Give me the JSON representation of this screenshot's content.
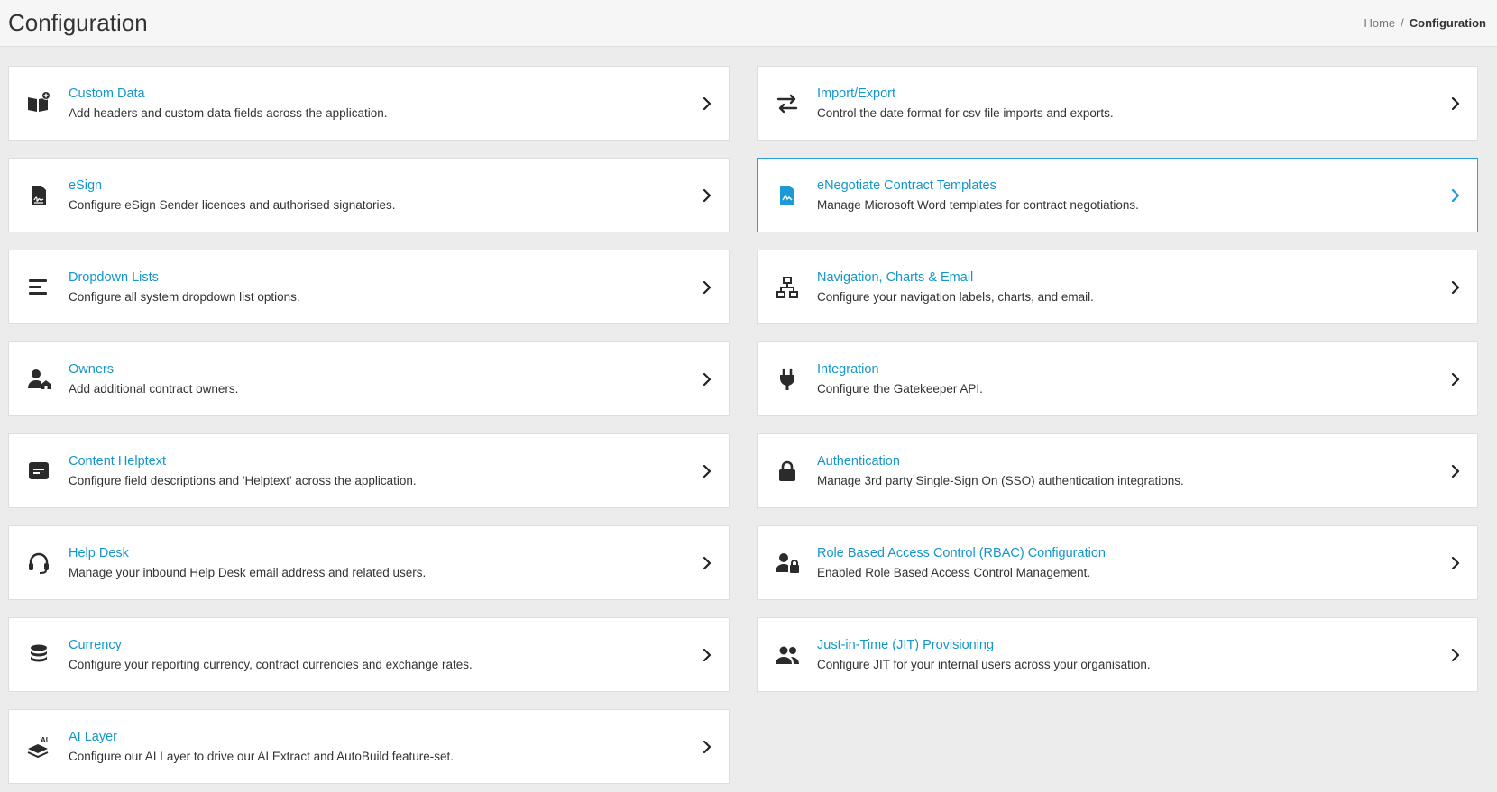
{
  "header": {
    "title": "Configuration",
    "breadcrumb": {
      "home": "Home",
      "separator": "/",
      "current": "Configuration"
    }
  },
  "colors": {
    "accent": "#1596c9",
    "active_border": "#2a9fd8"
  },
  "cards": [
    {
      "title": "Custom Data",
      "desc": "Add headers and custom data fields across the application.",
      "icon": "book-plus-icon"
    },
    {
      "title": "Import/Export",
      "desc": "Control the date format for csv file imports and exports.",
      "icon": "arrows-swap-icon"
    },
    {
      "title": "eSign",
      "desc": "Configure eSign Sender licences and authorised signatories.",
      "icon": "signed-document-icon"
    },
    {
      "title": "eNegotiate Contract Templates",
      "desc": "Manage Microsoft Word templates for contract negotiations.",
      "icon": "document-template-icon",
      "active": true
    },
    {
      "title": "Dropdown Lists",
      "desc": "Configure all system dropdown list options.",
      "icon": "list-lines-icon"
    },
    {
      "title": "Navigation, Charts & Email",
      "desc": "Configure your navigation labels, charts, and email.",
      "icon": "sitemap-icon"
    },
    {
      "title": "Owners",
      "desc": "Add additional contract owners.",
      "icon": "user-home-icon"
    },
    {
      "title": "Integration",
      "desc": "Configure the Gatekeeper API.",
      "icon": "plug-icon"
    },
    {
      "title": "Content Helptext",
      "desc": "Configure field descriptions and 'Helptext' across the application.",
      "icon": "message-box-icon"
    },
    {
      "title": "Authentication",
      "desc": "Manage 3rd party Single-Sign On (SSO) authentication integrations.",
      "icon": "lock-icon"
    },
    {
      "title": "Help Desk",
      "desc": "Manage your inbound Help Desk email address and related users.",
      "icon": "headset-icon"
    },
    {
      "title": "Role Based Access Control (RBAC) Configuration",
      "desc": "Enabled Role Based Access Control Management.",
      "icon": "user-lock-icon"
    },
    {
      "title": "Currency",
      "desc": "Configure your reporting currency, contract currencies and exchange rates.",
      "icon": "coins-stack-icon"
    },
    {
      "title": "Just-in-Time (JIT) Provisioning",
      "desc": "Configure JIT for your internal users across your organisation.",
      "icon": "users-icon"
    },
    {
      "title": "AI Layer",
      "desc": "Configure our AI Layer to drive our AI Extract and AutoBuild feature-set.",
      "icon": "ai-layers-icon",
      "badge": "AI"
    }
  ]
}
